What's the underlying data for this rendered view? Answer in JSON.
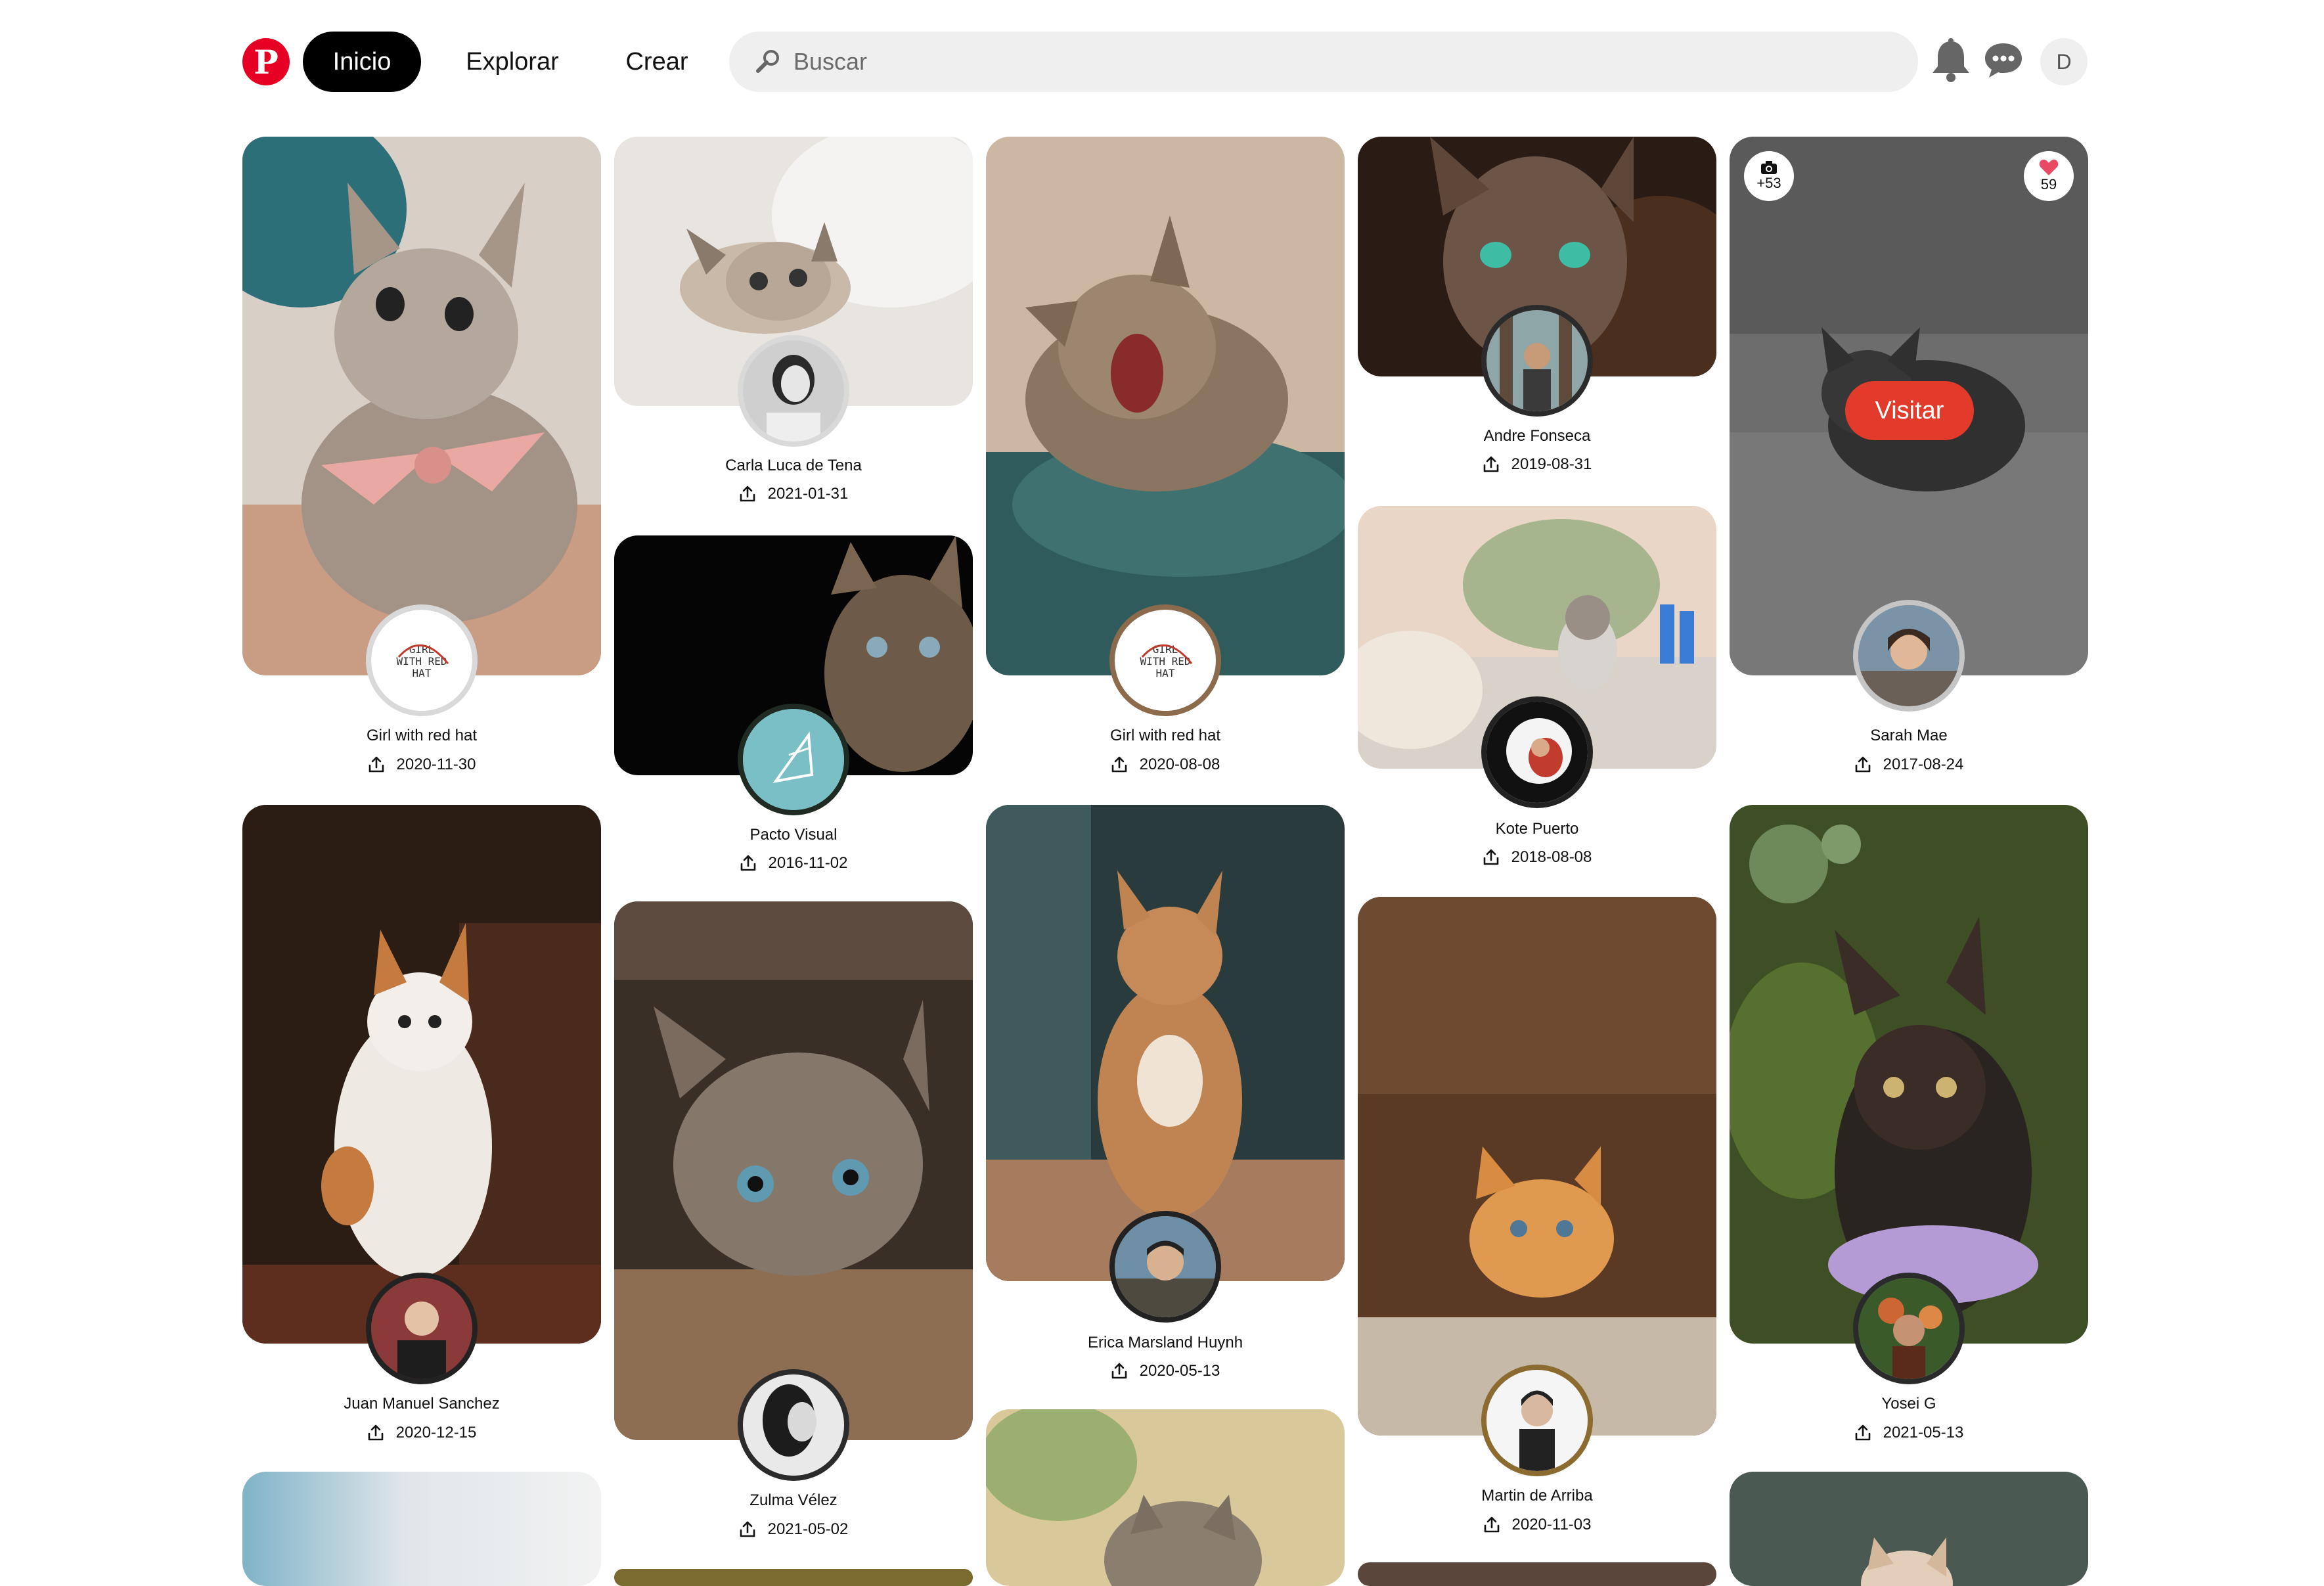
{
  "header": {
    "logo": "P",
    "nav": [
      {
        "label": "Inicio"
      },
      {
        "label": "Explorar"
      },
      {
        "label": "Crear"
      }
    ],
    "search_placeholder": "Buscar",
    "search_icon": "magnifier-icon",
    "notifications_icon": "bell-icon",
    "messages_icon": "chat-bubbles-icon",
    "profile_initial": "D"
  },
  "overlay": {
    "visit_label": "Visitar",
    "photo_count": "+53",
    "like_count": "59"
  },
  "pins": [
    {
      "author": "Girl with red hat",
      "date": "2020-11-30"
    },
    {
      "author": "Carla Luca de Tena",
      "date": "2021-01-31"
    },
    {
      "author": "Girl with red hat",
      "date": "2020-08-08"
    },
    {
      "author": "Andre Fonseca",
      "date": "2019-08-31"
    },
    {
      "author": "Sarah Mae",
      "date": "2017-08-24"
    },
    {
      "author": "Pacto Visual",
      "date": "2016-11-02"
    },
    {
      "author": "Kote Puerto",
      "date": "2018-08-08"
    },
    {
      "author": "Juan Manuel Sanchez",
      "date": "2020-12-15"
    },
    {
      "author": "Zulma Vélez",
      "date": "2021-05-02"
    },
    {
      "author": "Erica Marsland Huynh",
      "date": "2020-05-13"
    },
    {
      "author": "Martin de Arriba",
      "date": "2020-11-03"
    },
    {
      "author": "Yosei G",
      "date": "2021-05-13"
    }
  ],
  "colors": {
    "brand_red": "#e60023",
    "visit_red": "#e33b2b",
    "search_bg": "#efefef"
  }
}
